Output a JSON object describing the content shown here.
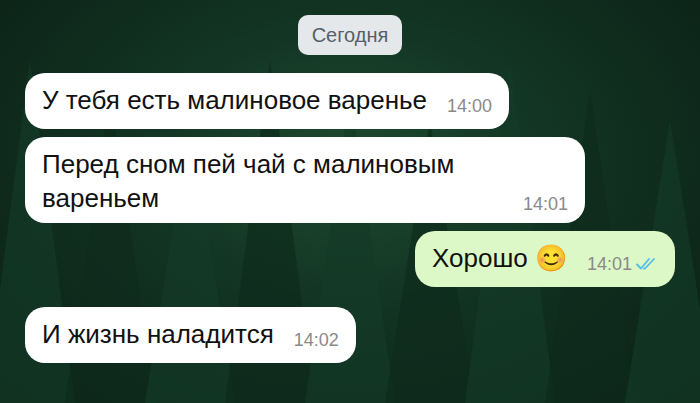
{
  "date_pill": "Сегодня",
  "messages": [
    {
      "kind": "incoming",
      "text": "У тебя есть малиновое варенье",
      "time": "14:00",
      "read": false
    },
    {
      "kind": "incoming",
      "text": "Перед сном пей чай с малиновым вареньем",
      "time": "14:01",
      "read": false
    },
    {
      "kind": "outgoing",
      "text": "Хорошо 😊",
      "time": "14:01",
      "read": true
    },
    {
      "kind": "incoming",
      "text": "И жизнь наладится",
      "time": "14:02",
      "read": false
    }
  ]
}
